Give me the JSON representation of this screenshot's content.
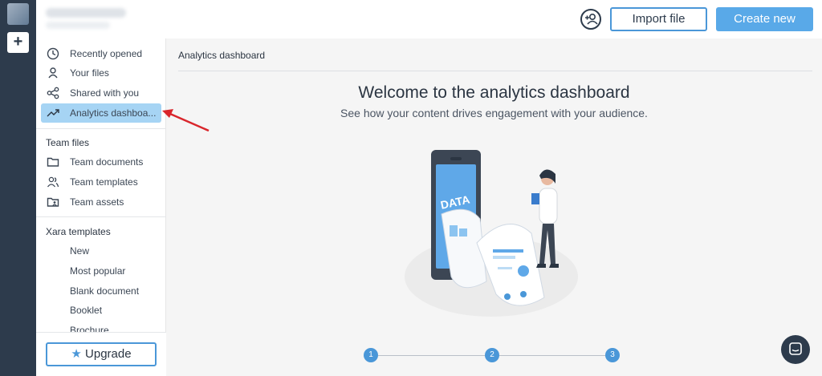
{
  "topbar": {
    "import_label": "Import file",
    "create_label": "Create new"
  },
  "sidebar": {
    "items": [
      {
        "label": "Recently opened",
        "icon": "clock-icon"
      },
      {
        "label": "Your files",
        "icon": "user-icon"
      },
      {
        "label": "Shared with you",
        "icon": "share-icon"
      },
      {
        "label": "Analytics dashboa...",
        "icon": "trend-icon",
        "active": true
      }
    ],
    "team_title": "Team files",
    "team_items": [
      {
        "label": "Team documents",
        "icon": "folder-icon"
      },
      {
        "label": "Team templates",
        "icon": "users-icon"
      },
      {
        "label": "Team assets",
        "icon": "folder-user-icon"
      }
    ],
    "xara_title": "Xara templates",
    "xara_items": [
      "New",
      "Most popular",
      "Blank document",
      "Booklet",
      "Brochure"
    ],
    "upgrade_label": "Upgrade"
  },
  "main": {
    "breadcrumb": "Analytics dashboard",
    "welcome": "Welcome to the analytics dashboard",
    "subtitle": "See how your content drives engagement with your audience.",
    "illustration_text": "DATA",
    "steps": [
      "1",
      "2",
      "3"
    ]
  },
  "colors": {
    "accent": "#4a97d8",
    "primary_button": "#59a9e8",
    "rail": "#2d3b4c",
    "active_item": "#a6d4f4",
    "arrow": "#d9262c"
  }
}
